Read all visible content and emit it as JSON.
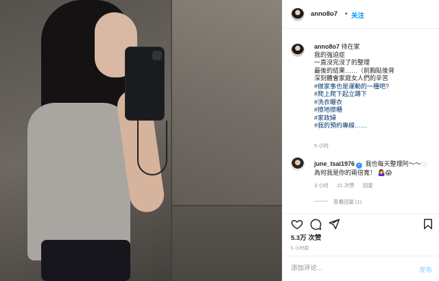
{
  "header": {
    "username": "anno8o7",
    "separator": "•",
    "follow_label": "关注"
  },
  "caption": {
    "username": "anno8o7",
    "lines": [
      "待在家",
      "我的強迫症",
      "一直沒完沒了的整理",
      "最後的結果……（前胸貼後背",
      "深刻體會家庭女人們的辛苦"
    ],
    "hashtags": [
      "#做家事也是運動的一種吧?",
      "#爬上爬下起立蹲下",
      "#洗衣曬衣",
      "#擦地擦櫃",
      "#家政婦",
      "#我的預約專線……"
    ],
    "time": "5 小时"
  },
  "reply": {
    "username": "june_tsai1976",
    "verified_icon": "✓",
    "text": "我也每天整理阿～～為何我是你的兩倍寬！ 🤷‍♀️😱",
    "like_icon": "♡",
    "time": "3 小时",
    "likes": "21 次赞",
    "reply_label": "回复",
    "view_replies": "查看回复 (1)"
  },
  "actions": {
    "like_icon": "heart-outline-icon",
    "comment_icon": "comment-icon",
    "share_icon": "send-icon",
    "save_icon": "bookmark-icon"
  },
  "stats": {
    "likes": "5.3万 次赞",
    "posted": "5 小时前"
  },
  "comment_box": {
    "placeholder": "添加评论...",
    "publish_label": "发布"
  },
  "colors": {
    "accent": "#0095f6",
    "link": "#00376b",
    "muted": "#8e8e8e",
    "border": "#efefef"
  }
}
